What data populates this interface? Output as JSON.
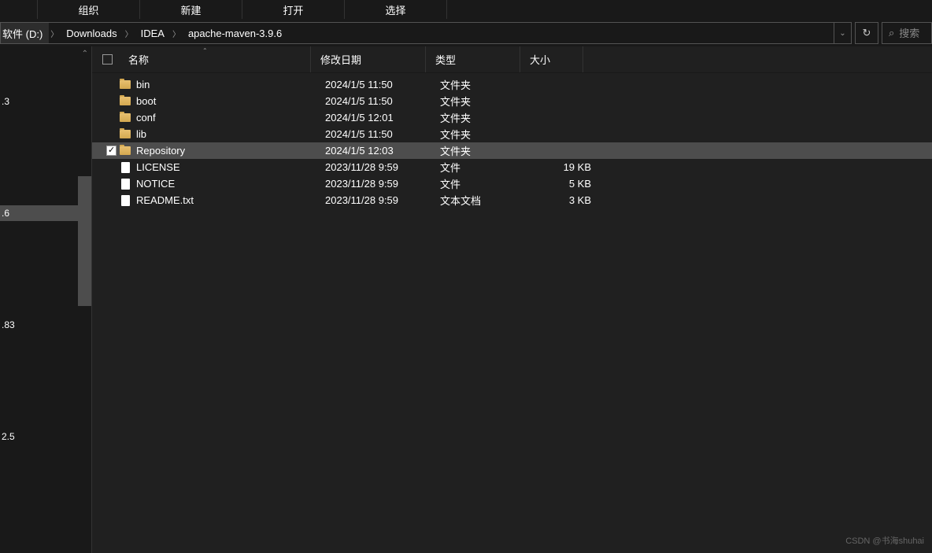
{
  "toolbar": {
    "items": [
      "组织",
      "新建",
      "打开",
      "选择"
    ]
  },
  "breadcrumb": {
    "items": [
      "软件 (D:)",
      "Downloads",
      "IDEA",
      "apache-maven-3.9.6"
    ]
  },
  "search": {
    "placeholder": "搜索"
  },
  "sidebar": {
    "items": [
      ".3",
      ".6",
      ".83",
      "2.5"
    ],
    "selected_index": 1
  },
  "columns": {
    "name": "名称",
    "date": "修改日期",
    "type": "类型",
    "size": "大小"
  },
  "files": [
    {
      "name": "bin",
      "date": "2024/1/5 11:50",
      "type": "文件夹",
      "size": "",
      "icon": "folder",
      "selected": false
    },
    {
      "name": "boot",
      "date": "2024/1/5 11:50",
      "type": "文件夹",
      "size": "",
      "icon": "folder",
      "selected": false
    },
    {
      "name": "conf",
      "date": "2024/1/5 12:01",
      "type": "文件夹",
      "size": "",
      "icon": "folder",
      "selected": false
    },
    {
      "name": "lib",
      "date": "2024/1/5 11:50",
      "type": "文件夹",
      "size": "",
      "icon": "folder",
      "selected": false
    },
    {
      "name": "Repository",
      "date": "2024/1/5 12:03",
      "type": "文件夹",
      "size": "",
      "icon": "folder",
      "selected": true
    },
    {
      "name": "LICENSE",
      "date": "2023/11/28 9:59",
      "type": "文件",
      "size": "19 KB",
      "icon": "file",
      "selected": false
    },
    {
      "name": "NOTICE",
      "date": "2023/11/28 9:59",
      "type": "文件",
      "size": "5 KB",
      "icon": "file",
      "selected": false
    },
    {
      "name": "README.txt",
      "date": "2023/11/28 9:59",
      "type": "文本文档",
      "size": "3 KB",
      "icon": "file",
      "selected": false
    }
  ],
  "watermark": "CSDN @书海shuhai"
}
